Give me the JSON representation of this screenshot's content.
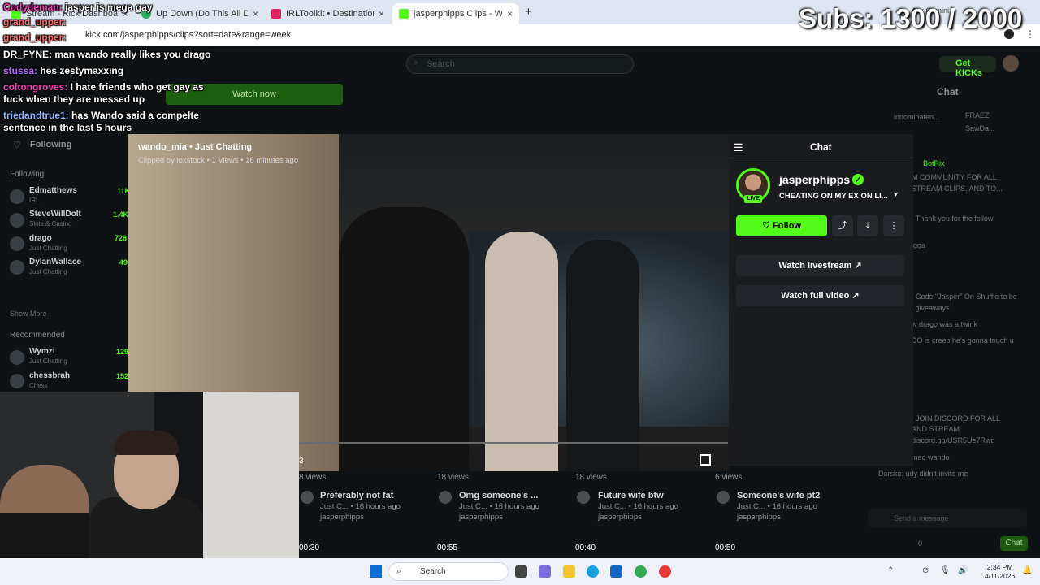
{
  "browser": {
    "tabs": [
      {
        "title": "Stream - Kick Dashboard",
        "favicon_color": "#53fc18"
      },
      {
        "title": "Up Down (Do This All Day) (fea",
        "favicon_color": "#27ae60"
      },
      {
        "title": "IRLToolkit • Destinations",
        "favicon_color": "#e0245e"
      },
      {
        "title": "jasperphipps Clips - Watch",
        "favicon_color": "#53fc18"
      }
    ],
    "new_tab": "+",
    "url": "kick.com/jasperphipps/clips?sort=date&range=week",
    "ask_gemini": "Ask Gemini"
  },
  "overlay": {
    "subs_counter": "Subs: 1300 / 2000",
    "chat": [
      {
        "user": "Codydeman:",
        "text": " jasper is mega gay"
      },
      {
        "user": "grand_upper:",
        "text": ""
      },
      {
        "user": "grand_upper:",
        "text": ""
      },
      {
        "user": "DR_FYNE:",
        "text": " man wando really likes you drago"
      },
      {
        "user": "stussa:",
        "text": " hes zestymaxxing"
      },
      {
        "user": "coltongroves:",
        "text": " I hate friends who get gay as"
      },
      {
        "user": "",
        "text": "fuck when they are messed up"
      },
      {
        "user": "triedandtrue1:",
        "text": " has Wando said a compelte"
      },
      {
        "user": "",
        "text": "sentence in the last 5 hours"
      }
    ]
  },
  "kick": {
    "search_placeholder": "Search",
    "get_kicks": "Get KICKs",
    "watch_now": "Watch now",
    "following_label": "Following",
    "sidebar": {
      "following_head": "Following",
      "following": [
        {
          "name": "Edmatthews",
          "sub": "IRL",
          "count": "11K"
        },
        {
          "name": "SteveWillDoIt",
          "sub": "Slots & Casino",
          "count": "1.4K"
        },
        {
          "name": "drago",
          "sub": "Just Chatting",
          "count": "728"
        },
        {
          "name": "DylanWallace",
          "sub": "Just Chatting",
          "count": "49"
        }
      ],
      "show_more": "Show More",
      "recommended_head": "Recommended",
      "recommended": [
        {
          "name": "Wymzi",
          "sub": "Just Chatting",
          "count": "129"
        },
        {
          "name": "chessbrah",
          "sub": "Chess",
          "count": "152"
        }
      ]
    },
    "clip": {
      "channel_category": "wando_mia • Just Chatting",
      "meta": "Clipped by loxstock • 1 Views • 16 minutes ago",
      "timecode": "3",
      "progress": 0.0
    },
    "panel": {
      "chat_title": "Chat",
      "channel_name": "jasperphipps",
      "live_badge": "LIVE",
      "stream_title": "CHEATING ON MY EX ON LI...",
      "follow": "Follow",
      "watch_livestream": "Watch livestream",
      "watch_full_video": "Watch full video"
    },
    "clips": [
      {
        "views": "8 views",
        "title": "Preferably not fat",
        "sub": "Just C... • 16 hours ago",
        "channel": "jasperphipps",
        "duration": "00:30"
      },
      {
        "views": "18 views",
        "title": "Omg someone's ...",
        "sub": "Just C... • 16 hours ago",
        "channel": "jasperphipps",
        "duration": "00:55"
      },
      {
        "views": "18 views",
        "title": "Future wife btw",
        "sub": "Just C... • 16 hours ago",
        "channel": "jasperphipps",
        "duration": "00:40"
      },
      {
        "views": "6 views",
        "title": "Someone's wife pt2",
        "sub": "Just C... • 16 hours ago",
        "channel": "jasperphipps",
        "duration": "00:50"
      }
    ],
    "right_chat": {
      "title": "Chat",
      "top_users": [
        "innominaten...",
        "FRAEZ",
        "SawDa..."
      ],
      "lines": [
        "BotRix",
        "M COMMUNITY FOR ALL",
        "STREAM CLIPS, AND TO...",
        ": Thank you for the follow",
        "igga",
        ": Code \"Jasper\" On Shuffle to be",
        "l giveaways",
        "w drago was a twink",
        "DO is creep he's gonna touch u",
        ": JOIN DISCORD FOR ALL",
        "AND STREAM",
        "discord.gg/USR5Ue7Rwd",
        "mao wando",
        "Dorsko: udy didn't invite me"
      ],
      "send_placeholder": "Send a message",
      "kicks_count": "0",
      "chat_button": "Chat"
    }
  },
  "taskbar": {
    "search": "Search",
    "time": "2:34 PM",
    "date": "4/11/2026"
  }
}
